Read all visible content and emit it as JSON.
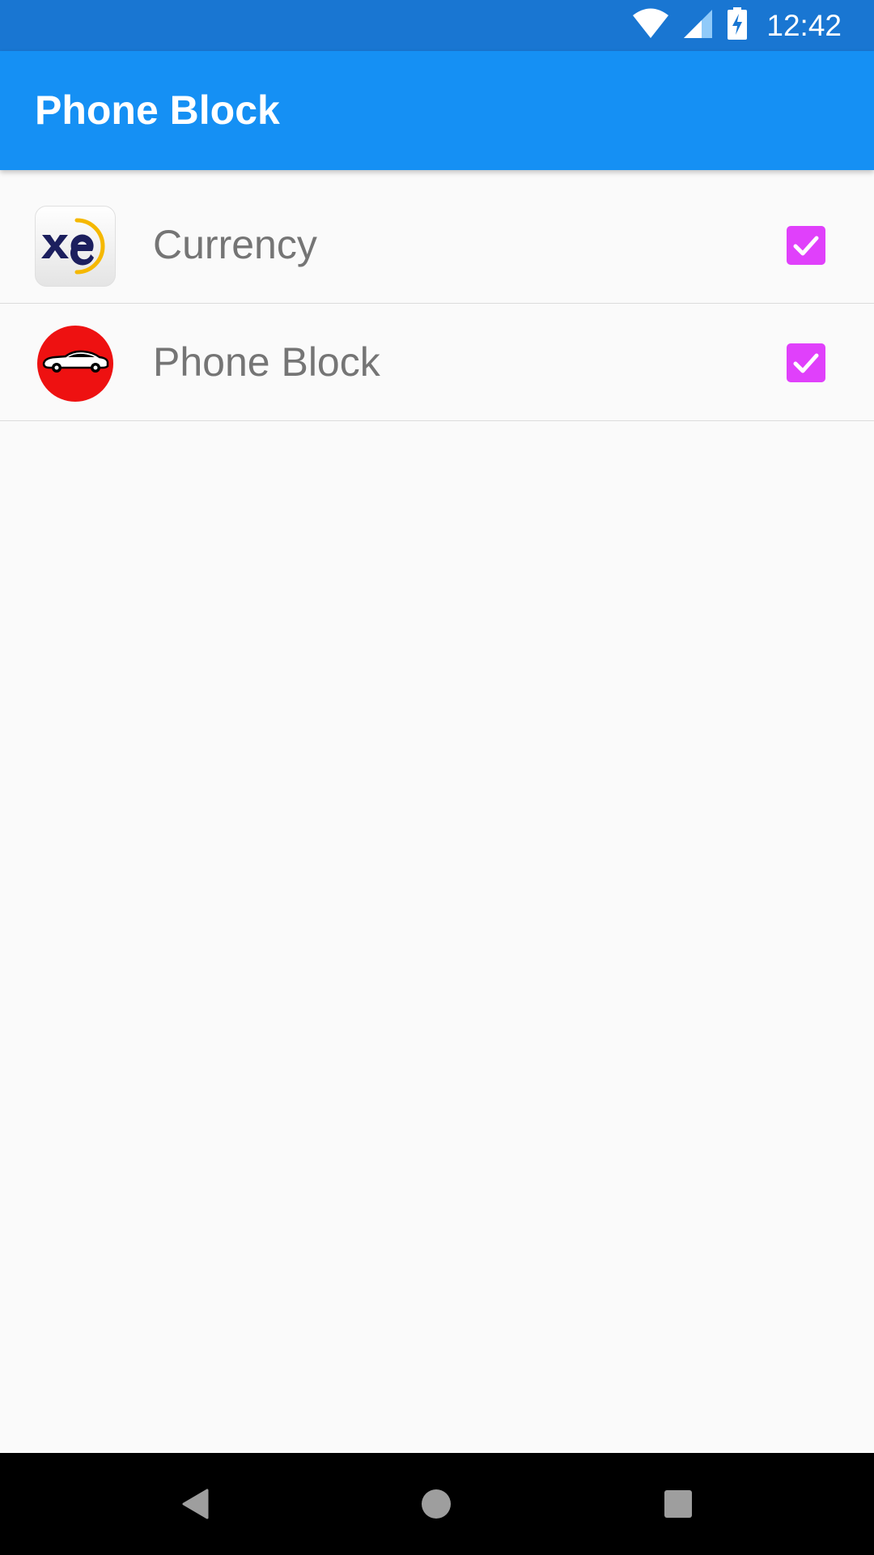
{
  "status_bar": {
    "time": "12:42",
    "icons": [
      "wifi-icon",
      "cell-signal-icon",
      "battery-charging-icon"
    ]
  },
  "app_bar": {
    "title": "Phone Block",
    "color": "#1590f4"
  },
  "list": {
    "items": [
      {
        "label": "Currency",
        "icon": "xe-currency-app-icon",
        "checked": true
      },
      {
        "label": "Phone Block",
        "icon": "red-car-app-icon",
        "checked": true
      }
    ]
  },
  "colors": {
    "status_bar": "#1976d2",
    "app_bar": "#1590f4",
    "checkbox": "#e040fb",
    "label_text": "#757575",
    "background": "#fafafa"
  },
  "nav_bar": {
    "buttons": [
      "back-icon",
      "home-icon",
      "recents-icon"
    ]
  }
}
